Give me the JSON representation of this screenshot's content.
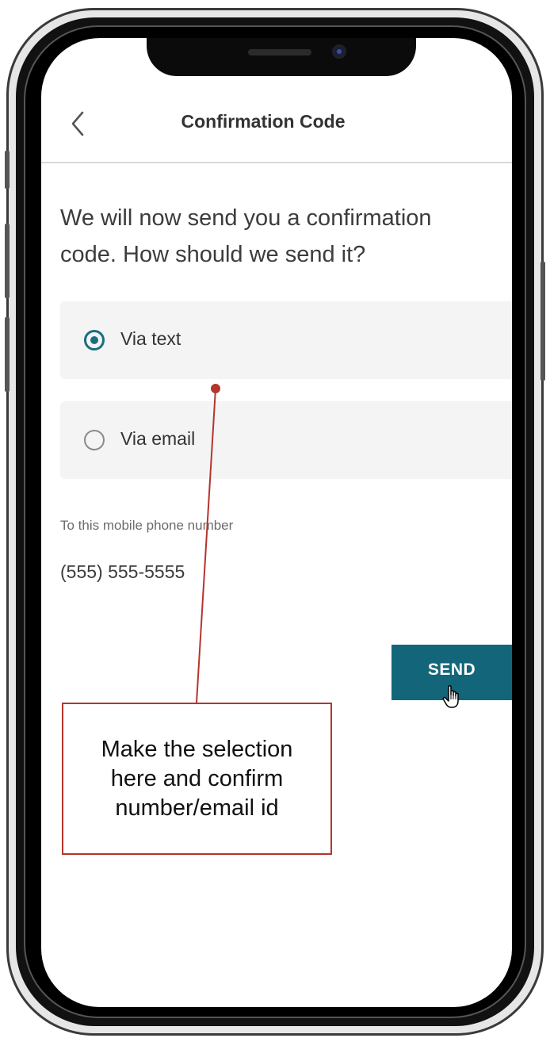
{
  "header": {
    "title": "Confirmation Code",
    "back_icon": "chevron-left-icon"
  },
  "prompt": "We will now send you a confirmation code. How should we send it?",
  "options": [
    {
      "label": "Via text",
      "selected": true
    },
    {
      "label": "Via email",
      "selected": false
    }
  ],
  "destination": {
    "label": "To this mobile phone number",
    "value": "(555) 555-5555"
  },
  "send_button": {
    "label": "SEND"
  },
  "annotation": {
    "text": "Make the selection here and confirm number/email id",
    "color": "#b5342e"
  },
  "colors": {
    "accent": "#13667a",
    "radio": "#1a6f7f",
    "option_bg": "#f4f4f4"
  }
}
